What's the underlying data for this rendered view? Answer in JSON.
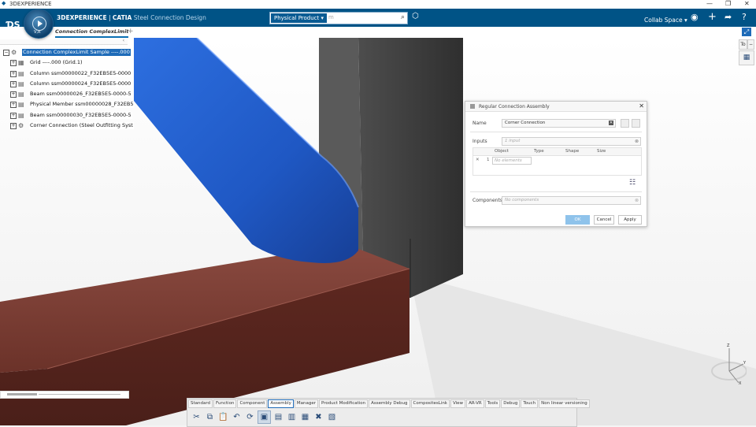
{
  "app": {
    "name": "3DEXPERIENCE"
  },
  "window_controls": [
    "—",
    "❐",
    "✕"
  ],
  "brand": {
    "product": "3DEXPERIENCE",
    "app": "CATIA",
    "module": "Steel Connection Design"
  },
  "compass": {
    "label": "V,R"
  },
  "search": {
    "dropdown": "Physical Product",
    "placeholder": "m"
  },
  "user": {
    "space": "Collab Space"
  },
  "tabs": [
    {
      "label": "Connection ComplexLimit"
    }
  ],
  "tree": [
    {
      "label": "Connection ComplexLimit Sample ----.000",
      "expanded": true
    },
    {
      "label": "Grid ----.000 (Grid.1)"
    },
    {
      "label": "Column ssm00000022_F32EB5E5-0000"
    },
    {
      "label": "Column ssm00000024_F32EB5E5-0000"
    },
    {
      "label": "Beam ssm00000026_F32EB5E5-0000-5"
    },
    {
      "label": "Physical Member ssm00000028_F32EB5"
    },
    {
      "label": "Beam ssm00000030_F32EB5E5-0000-5"
    },
    {
      "label": "Corner Connection (Steel Outfitting Syst"
    }
  ],
  "dialog": {
    "title": "Regular Connection Assembly",
    "name_label": "Name",
    "name_value": "Corner Connection",
    "inputs_label": "Inputs",
    "inputs_placeholder": "1 input",
    "columns": [
      "Object",
      "Type",
      "Shape",
      "Size"
    ],
    "row_remove": "✕",
    "row_index": "1",
    "row_value": "No elements",
    "components_label": "Components",
    "components_placeholder": "No components",
    "ok": "OK",
    "cancel": "Cancel",
    "apply": "Apply"
  },
  "side_panel": {
    "label": "To"
  },
  "action_bar": {
    "tabs": [
      "Standard",
      "Function",
      "Component",
      "Assembly",
      "Manager",
      "Product Modification",
      "Assembly Debug",
      "CompositesLink",
      "View",
      "AR-VR",
      "Tools",
      "Debug",
      "Touch",
      "Non linear versioning"
    ],
    "active_tab": "Assembly"
  },
  "compass_axes": {
    "z": "Z",
    "y": "Y",
    "x": "X"
  },
  "colors": {
    "topbar": "#005386",
    "beam_blue": "#1f5fd0",
    "beam_brown": "#6b2f27",
    "column_dark": "#3a3a3a",
    "accent": "#1e6bb8"
  }
}
